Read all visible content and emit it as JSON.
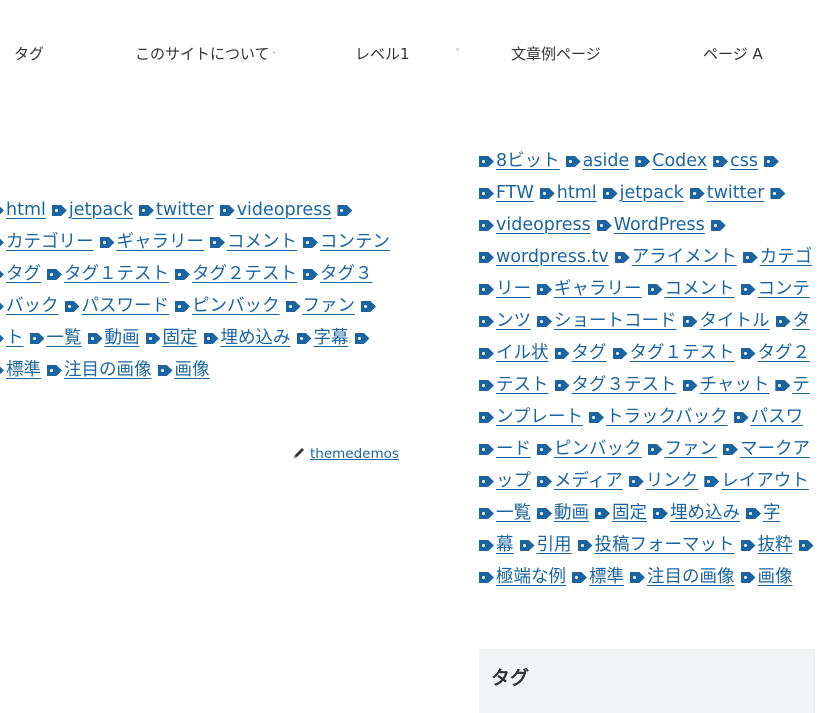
{
  "nav": {
    "items": [
      {
        "label": "タグ",
        "has_submenu": false
      },
      {
        "label": "このサイトについて",
        "has_submenu": true
      },
      {
        "label": "レベル1",
        "has_submenu": true
      },
      {
        "label": "文章例ページ",
        "has_submenu": false
      },
      {
        "label": "ページ A",
        "has_submenu": false
      }
    ],
    "chevron_glyph": "˅"
  },
  "content_tags": {
    "lines": [
      [
        "html",
        "jetpack",
        "twitter",
        "videopress",
        ""
      ],
      [
        "カテゴリー",
        "ギャラリー",
        "コメント",
        "コンテン"
      ],
      [
        "タグ",
        "タグ１テスト",
        "タグ２テスト",
        "タグ３"
      ],
      [
        "バック",
        "パスワード",
        "ピンバック",
        "ファン",
        ""
      ],
      [
        "ト",
        "一覧",
        "動画",
        "固定",
        "埋め込み",
        "字幕",
        ""
      ],
      [
        "標準",
        "注目の画像",
        "画像"
      ]
    ]
  },
  "post_meta": {
    "author": "themedemos",
    "author_icon": "pencil-icon"
  },
  "sidebar_tags": {
    "lines": [
      [
        "8ビット",
        "aside",
        "Codex",
        "css",
        ""
      ],
      [
        "FTW",
        "html",
        "jetpack",
        "twitter",
        ""
      ],
      [
        "videopress",
        "WordPress",
        ""
      ],
      [
        "wordpress.tv",
        "アライメント",
        "カテゴ"
      ],
      [
        "リー",
        "ギャラリー",
        "コメント",
        "コンテ"
      ],
      [
        "ンツ",
        "ショートコード",
        "タイトル",
        "タ"
      ],
      [
        "イル状",
        "タグ",
        "タグ１テスト",
        "タグ２"
      ],
      [
        "テスト",
        "タグ３テスト",
        "チャット",
        "テ"
      ],
      [
        "ンプレート",
        "トラックバック",
        "パスワ"
      ],
      [
        "ード",
        "ピンバック",
        "ファン",
        "マークア"
      ],
      [
        "ップ",
        "メディア",
        "リンク",
        "レイアウト"
      ],
      [
        "一覧",
        "動画",
        "固定",
        "埋め込み",
        "字"
      ],
      [
        "幕",
        "引用",
        "投稿フォーマット",
        "抜粋",
        ""
      ],
      [
        "極端な例",
        "標準",
        "注目の画像",
        "画像"
      ]
    ]
  },
  "sidebar_widget": {
    "title": "タグ"
  },
  "colors": {
    "link": "#1a65a0",
    "text": "#333333",
    "widget_bg": "#f2f3f4"
  }
}
